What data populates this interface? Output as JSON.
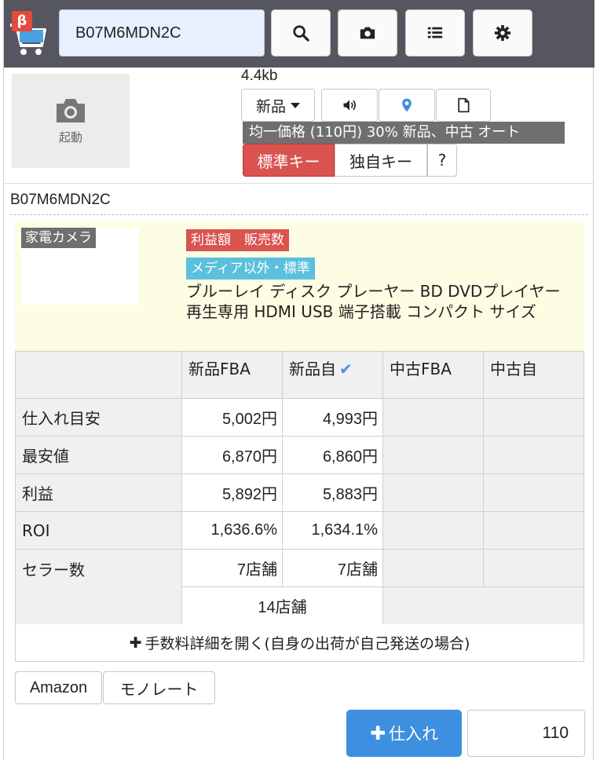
{
  "search": {
    "value": "B07M6MDN2C"
  },
  "logo": {
    "badge": "β"
  },
  "topbar": {
    "launch_label": "起動",
    "size": "4.4kb",
    "condition": "新品",
    "price_info": "均一価格 (110円)  30%  新品、中古  オート"
  },
  "keys": {
    "standard": "標準キー",
    "own": "独自キー",
    "help": "?"
  },
  "product": {
    "asin": "B07M6MDN2C",
    "category": "家電カメラ",
    "tag_profit": "利益額　販売数",
    "tag_media": "メディア以外・標準",
    "title": "ブルーレイ ディスク プレーヤー BD DVDプレイヤー 再生専用 HDMI USB 端子搭載 コンパクト サイズ"
  },
  "table": {
    "headers": [
      "新品FBA",
      "新品自",
      "中古FBA",
      "中古自"
    ],
    "check": "✔",
    "rows": [
      {
        "label": "仕入れ目安",
        "values": [
          "5,002円",
          "4,993円",
          "",
          ""
        ]
      },
      {
        "label": "最安値",
        "values": [
          "6,870円",
          "6,860円",
          "",
          ""
        ]
      },
      {
        "label": "利益",
        "values": [
          "5,892円",
          "5,883円",
          "",
          ""
        ]
      },
      {
        "label": "ROI",
        "values": [
          "1,636.6%",
          "1,634.1%",
          "",
          ""
        ]
      },
      {
        "label": "セラー数",
        "values": [
          "7店舗",
          "7店舗",
          "",
          ""
        ]
      }
    ],
    "total_sellers": "14店舗"
  },
  "fee_toggle": "手数料詳細を開く(自身の出荷が自己発送の場合)",
  "links": {
    "amazon": "Amazon",
    "monorate": "モノレート"
  },
  "purchase": {
    "label": "仕入れ",
    "quantity": "110"
  },
  "colors": {
    "header": "#55565f",
    "accent_red": "#d9534f",
    "accent_blue": "#5bc0de",
    "primary": "#3d8fe0"
  }
}
